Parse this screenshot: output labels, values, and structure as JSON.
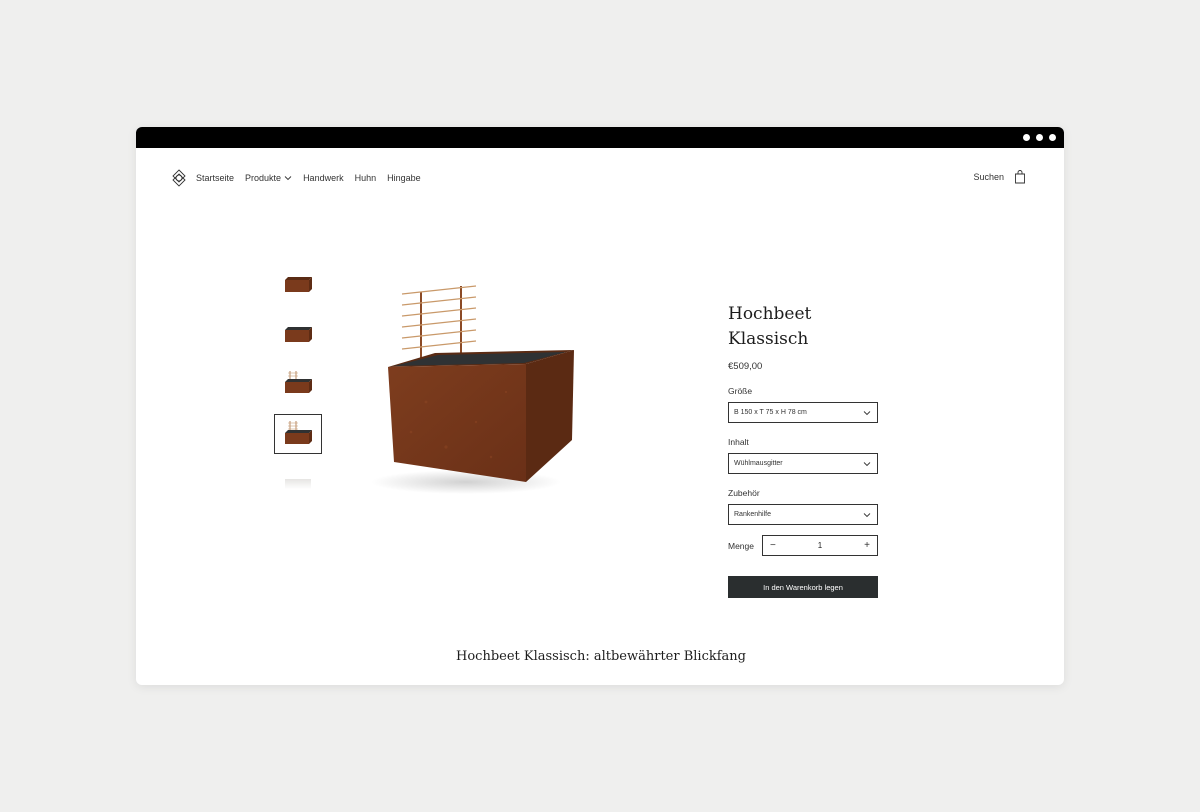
{
  "nav": {
    "links": [
      "Startseite",
      "Produkte",
      "Handwerk",
      "Huhn",
      "Hingabe"
    ],
    "search_label": "Suchen"
  },
  "product": {
    "title_line1": "Hochbeet",
    "title_line2": "Klassisch",
    "price": "€509,00",
    "options": [
      {
        "label": "Größe",
        "value": "B 150 x T 75 x H 78 cm"
      },
      {
        "label": "Inhalt",
        "value": "Wühlmausgitter"
      },
      {
        "label": "Zubehör",
        "value": "Rankenhilfe"
      }
    ],
    "quantity_label": "Menge",
    "quantity": "1",
    "add_to_cart": "In den Warenkorb legen"
  },
  "thumbnails": {
    "selected_index": 3,
    "count": 5
  },
  "caption": "Hochbeet Klassisch: altbewährter Blickfang",
  "colors": {
    "rust": "#7a3a1c",
    "button": "#2a2e2f",
    "background": "#efefee"
  },
  "icons": [
    "logo-icon",
    "chevron-down-icon",
    "shopping-bag-icon",
    "minus-icon",
    "plus-icon",
    "more-dots-icon"
  ]
}
